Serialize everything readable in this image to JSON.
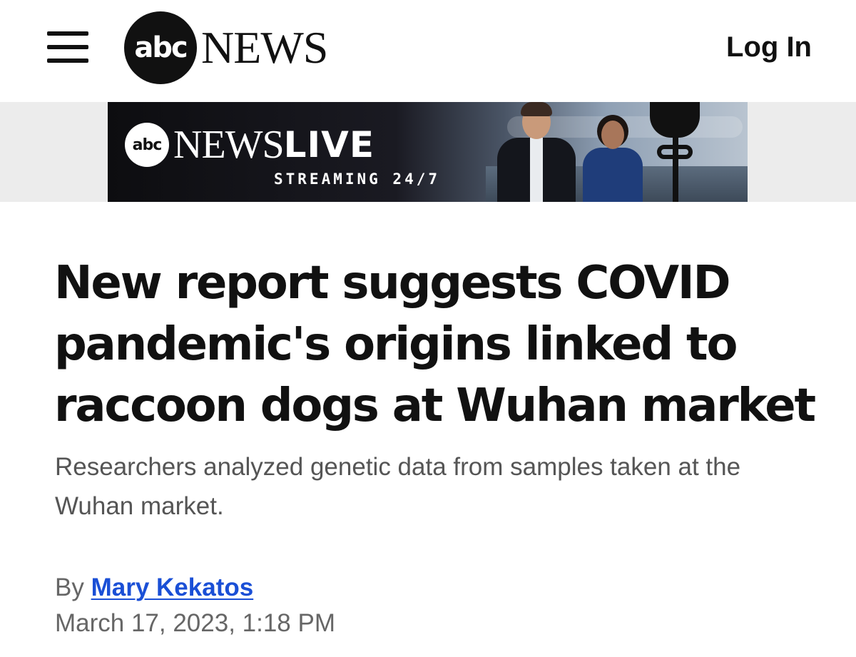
{
  "header": {
    "menu_icon": "hamburger-menu-icon",
    "logo_mark": "abc",
    "logo_word": "NEWS",
    "login_label": "Log In"
  },
  "promo": {
    "abc_mark": "abc",
    "news_word": "NEWS",
    "live_word": "LIVE",
    "tagline": "STREAMING 24/7"
  },
  "article": {
    "headline": "New report suggests COVID pandemic's origins linked to raccoon dogs at Wuhan market",
    "subheadline": "Researchers analyzed genetic data from samples taken at the Wuhan market.",
    "byline_prefix": "By",
    "author": "Mary Kekatos",
    "date": "March 17, 2023, 1:18 PM"
  },
  "colors": {
    "link": "#1a4fd6",
    "text": "#111111",
    "muted": "#666666"
  }
}
